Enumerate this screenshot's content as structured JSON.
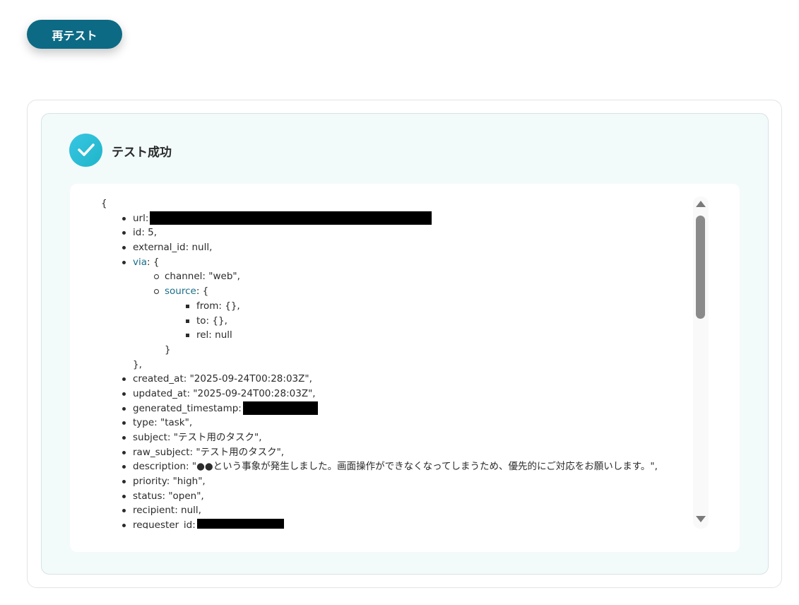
{
  "retest_button": {
    "label": "再テスト"
  },
  "status": {
    "title": "テスト成功"
  },
  "result": {
    "open_brace": "{",
    "fields": {
      "url": "url:",
      "id": "id: 5,",
      "external_id": "external_id: null,",
      "via_key": "via",
      "via_rest": ": {",
      "channel": "channel: \"web\",",
      "source_key": "source",
      "source_rest": ": {",
      "from": "from: {},",
      "to": "to: {},",
      "rel": "rel: null",
      "source_close": "}",
      "via_close": "},",
      "created_at": "created_at: \"2025-09-24T00:28:03Z\",",
      "updated_at": "updated_at: \"2025-09-24T00:28:03Z\",",
      "generated_timestamp": "generated_timestamp:",
      "type": "type: \"task\",",
      "subject": "subject: \"テスト用のタスク\",",
      "raw_subject": "raw_subject: \"テスト用のタスク\",",
      "description": "description: \"●●という事象が発生しました。画面操作ができなくなってしまうため、優先的にご対応をお願いします。\",",
      "priority": "priority: \"high\",",
      "status": "status: \"open\",",
      "recipient": "recipient: null,",
      "requester_id": "requester_id:"
    }
  },
  "colors": {
    "button_bg": "#0d6a85",
    "success_icon": "#2bbfd6",
    "card_bg": "#f3fafa",
    "key_link": "#1a6e8a"
  },
  "icons": {
    "status": "check-icon",
    "scroll_up": "triangle-up-icon",
    "scroll_down": "triangle-down-icon"
  }
}
